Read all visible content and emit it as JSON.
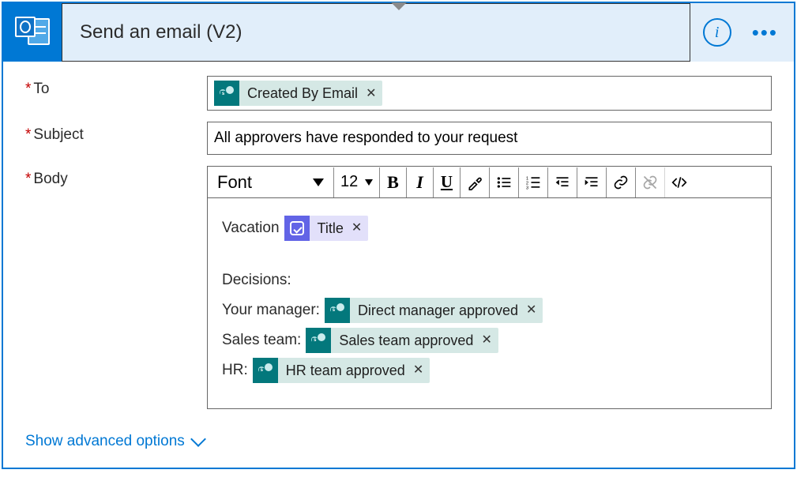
{
  "header": {
    "title": "Send an email (V2)",
    "info_tooltip": "i"
  },
  "fields": {
    "to": {
      "label": "To",
      "required": true
    },
    "subject": {
      "label": "Subject",
      "required": true,
      "value": "All approvers have responded to your request"
    },
    "body": {
      "label": "Body",
      "required": true
    }
  },
  "tokens": {
    "to_created_by": "Created By Email",
    "title": "Title",
    "direct_mgr": "Direct manager approved",
    "sales": "Sales team approved",
    "hr": "HR team approved"
  },
  "body_text": {
    "vacation": "Vacation",
    "decisions": "Decisions:",
    "your_manager": "Your manager:",
    "sales_team": "Sales team:",
    "hr": "HR:"
  },
  "toolbar": {
    "font": "Font",
    "size": "12"
  },
  "footer": {
    "advanced": "Show advanced options"
  }
}
